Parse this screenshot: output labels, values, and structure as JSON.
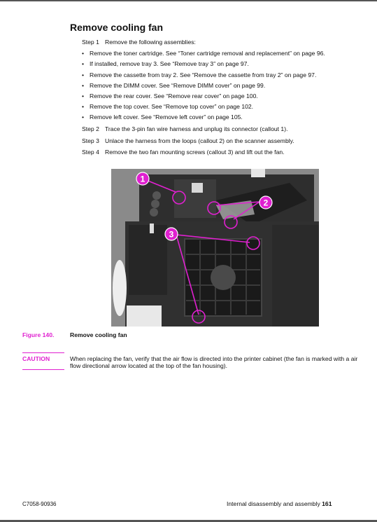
{
  "page": {
    "title": "Remove cooling fan",
    "steps": [
      {
        "label": "Step 1",
        "text": "Remove the following assemblies:"
      },
      {
        "label": "Step 2",
        "text": "Trace the 3-pin fan wire harness and unplug its connector (callout 1)."
      },
      {
        "label": "Step 3",
        "text": "Unlace the harness from the loops (callout 2) on the scanner assembly."
      },
      {
        "label": "Step 4",
        "text": "Remove the two fan mounting screws (callout 3) and lift out the fan."
      }
    ],
    "bullets": [
      "Remove the toner cartridge. See “Toner cartridge removal and replacement” on page 96.",
      "If installed, remove tray 3. See “Remove tray 3” on page 97.",
      "Remove the cassette from tray 2. See “Remove the cassette from tray 2” on page 97.",
      "Remove the DIMM cover. See “Remove DIMM cover” on page 99.",
      "Remove the rear cover. See “Remove rear cover” on page 100.",
      "Remove the top cover. See “Remove top cover” on page 102.",
      "Remove left cover. See “Remove left cover” on page 105."
    ],
    "bullet_glyph": "•",
    "figure": {
      "number": "Figure 140.",
      "caption": "Remove cooling fan",
      "callouts": [
        "1",
        "2",
        "3"
      ],
      "callout_color": "#e020d0"
    },
    "caution": {
      "label": "CAUTION",
      "text": "When replacing the fan, verify that the air flow is directed into the printer cabinet (the fan is marked with a air flow directional arrow located at the top of the fan housing)."
    },
    "footer": {
      "doc_number": "C7058-90936",
      "section": "Internal disassembly and assembly",
      "page_number": "161"
    }
  }
}
